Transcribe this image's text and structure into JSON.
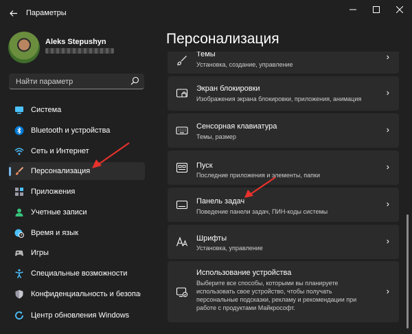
{
  "window": {
    "title": "Параметры",
    "back_icon": "arrow-left-icon"
  },
  "user": {
    "name": "Aleks Stepushyn"
  },
  "search": {
    "placeholder": "Найти параметр"
  },
  "sidebar": {
    "items": [
      {
        "label": "Система",
        "icon": "display-icon",
        "selected": false
      },
      {
        "label": "Bluetooth и устройства",
        "icon": "bluetooth-icon",
        "selected": false
      },
      {
        "label": "Сеть и Интернет",
        "icon": "wifi-icon",
        "selected": false
      },
      {
        "label": "Персонализация",
        "icon": "brush-icon",
        "selected": true
      },
      {
        "label": "Приложения",
        "icon": "apps-icon",
        "selected": false
      },
      {
        "label": "Учетные записи",
        "icon": "person-icon",
        "selected": false
      },
      {
        "label": "Время и язык",
        "icon": "globe-clock-icon",
        "selected": false
      },
      {
        "label": "Игры",
        "icon": "gamepad-icon",
        "selected": false
      },
      {
        "label": "Специальные возможности",
        "icon": "accessibility-icon",
        "selected": false
      },
      {
        "label": "Конфиденциальность и безопасность",
        "icon": "shield-icon",
        "selected": false
      },
      {
        "label": "Центр обновления Windows",
        "icon": "update-icon",
        "selected": false
      }
    ]
  },
  "main": {
    "title": "Персонализация",
    "cards": [
      {
        "title": "Темы",
        "desc": "Установка, создание, управление",
        "icon": "brush-icon"
      },
      {
        "title": "Экран блокировки",
        "desc": "Изображения экрана блокировки, приложения, анимация",
        "icon": "lock-screen-icon"
      },
      {
        "title": "Сенсорная клавиатура",
        "desc": "Темы, размер",
        "icon": "keyboard-icon"
      },
      {
        "title": "Пуск",
        "desc": "Последние приложения и элементы, папки",
        "icon": "start-icon"
      },
      {
        "title": "Панель задач",
        "desc": "Поведение панели задач, ПИН-коды системы",
        "icon": "taskbar-icon"
      },
      {
        "title": "Шрифты",
        "desc": "Установка, управление",
        "icon": "font-icon"
      },
      {
        "title": "Использование устройства",
        "desc": "Выберите все способы, которыми вы планируете использовать свое устройство, чтобы получать персональные подсказки, рекламу и рекомендации при работе с продуктами Майкрософт.",
        "icon": "device-usage-icon"
      }
    ]
  },
  "colors": {
    "accent": "#76b9ed",
    "annotation_arrow": "#e8322b",
    "background": "#202020",
    "card": "#2b2b2b"
  }
}
